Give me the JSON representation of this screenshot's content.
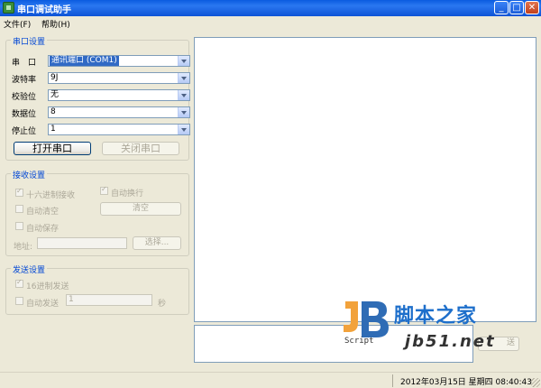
{
  "window": {
    "title": "串口调试助手",
    "buttons": {
      "minimize": "_",
      "maximize": "□",
      "close": "✕"
    }
  },
  "menu": {
    "items": [
      {
        "label": "文件(F)"
      },
      {
        "label": "帮助(H)"
      }
    ]
  },
  "serial_settings": {
    "title": "串口设置",
    "port": {
      "label": "串　口",
      "value": "通讯端口 (COM1)"
    },
    "baud": {
      "label": "波特率",
      "value": "9J"
    },
    "parity": {
      "label": "校验位",
      "value": "无"
    },
    "databits": {
      "label": "数据位",
      "value": "8"
    },
    "stopbits": {
      "label": "停止位",
      "value": "1"
    },
    "open_button": "打开串口",
    "close_button": "关闭串口"
  },
  "receive_settings": {
    "title": "接收设置",
    "hex_receive": "十六进制接收",
    "auto_newline": "自动换行",
    "auto_clear": "自动清空",
    "clear_button": "清空",
    "auto_save": "自动保存",
    "address_label": "地址:",
    "address_value": "",
    "browse_button": "选择..."
  },
  "send_settings": {
    "title": "发送设置",
    "hex_send": "16进制发送",
    "auto_send": "自动发送",
    "interval_value": "1",
    "interval_unit": "秒"
  },
  "send_button": "送",
  "watermark": {
    "logo_text": "Script",
    "cn_text": "脚本之家",
    "url_text": "jb51.net"
  },
  "status": {
    "datetime": "2012年03月15日  星期四  08:40:43"
  },
  "colors": {
    "titlebar": "#0A5BE0",
    "group_title": "#0046D5",
    "window_bg": "#ECE9D8",
    "watermark_blue": "#1E6FCB"
  }
}
